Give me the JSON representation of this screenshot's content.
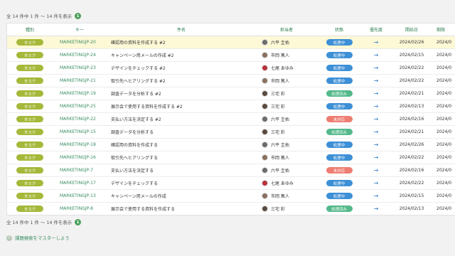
{
  "summary": {
    "text": "全 14 件中 1 件 〜 14 件を表示",
    "badge": "1"
  },
  "headers": {
    "type": "種別",
    "key": "キー",
    "subject": "件名",
    "assignee": "担当者",
    "status": "状態",
    "priority": "優先度",
    "start": "開始日",
    "due": "期限"
  },
  "colors": {
    "type": "#a6b83a",
    "processing": "#3d8fd6",
    "done": "#54b98b",
    "open": "#ee7d72",
    "accent": "#3a8e63"
  },
  "rows": [
    {
      "type": "タスク",
      "key": "MARKETINGJP-20",
      "subject": "確認用の資料を作成する #2",
      "assignee": "六平 圭佑",
      "status": "処理中",
      "status_kind": "processing",
      "priority_icon": "arrow-right-icon",
      "start": "2024/02/26",
      "due": "2024/0",
      "avatar": "#6b6b6b"
    },
    {
      "type": "タスク",
      "key": "MARKETINGJP-24",
      "subject": "キャンペーン用メールの作成 #2",
      "assignee": "市岡 篤人",
      "status": "処理中",
      "status_kind": "processing",
      "priority_icon": "arrow-right-icon",
      "start": "2024/02/15",
      "due": "2024/0",
      "avatar": "#8a7060"
    },
    {
      "type": "タスク",
      "key": "MARKETINGJP-23",
      "subject": "デザインをチェックする #2",
      "assignee": "七尾 あゆみ",
      "status": "処理中",
      "status_kind": "processing",
      "priority_icon": "arrow-right-icon",
      "start": "2024/02/22",
      "due": "2024/0",
      "avatar": "#b8323a"
    },
    {
      "type": "タスク",
      "key": "MARKETINGJP-21",
      "subject": "取引先へヒアリングする #2",
      "assignee": "市岡 篤人",
      "status": "処理中",
      "status_kind": "processing",
      "priority_icon": "arrow-right-icon",
      "start": "2024/02/22",
      "due": "2024/0",
      "avatar": "#8a7060"
    },
    {
      "type": "タスク",
      "key": "MARKETINGJP-19",
      "subject": "調査データを分析する #2",
      "assignee": "三宅 彩",
      "status": "処理済み",
      "status_kind": "done",
      "priority_icon": "arrow-right-icon",
      "start": "2024/02/21",
      "due": "2024/0",
      "avatar": "#5a4a40"
    },
    {
      "type": "タスク",
      "key": "MARKETINGJP-25",
      "subject": "展示会で使用する資料を作成する #2",
      "assignee": "三宅 彩",
      "status": "処理中",
      "status_kind": "processing",
      "priority_icon": "arrow-right-icon",
      "start": "2024/02/13",
      "due": "2024/0",
      "avatar": "#5a4a40"
    },
    {
      "type": "タスク",
      "key": "MARKETINGJP-22",
      "subject": "支払い方法を決定する #2",
      "assignee": "六平 圭佑",
      "status": "未対応",
      "status_kind": "open",
      "priority_icon": "arrow-right-icon",
      "start": "2024/02/16",
      "due": "2024/0",
      "avatar": "#6b6b6b"
    },
    {
      "type": "タスク",
      "key": "MARKETINGJP-15",
      "subject": "調査データを分析する",
      "assignee": "三宅 彩",
      "status": "処理済み",
      "status_kind": "done",
      "priority_icon": "arrow-right-icon",
      "start": "2024/02/21",
      "due": "2024/0",
      "avatar": "#5a4a40"
    },
    {
      "type": "タスク",
      "key": "MARKETINGJP-18",
      "subject": "確認用の資料を作成する",
      "assignee": "六平 圭佑",
      "status": "処理中",
      "status_kind": "processing",
      "priority_icon": "arrow-right-icon",
      "start": "2024/02/26",
      "due": "2024/0",
      "avatar": "#6b6b6b"
    },
    {
      "type": "タスク",
      "key": "MARKETINGJP-16",
      "subject": "取引先へヒアリングする",
      "assignee": "市岡 篤人",
      "status": "処理中",
      "status_kind": "processing",
      "priority_icon": "arrow-right-icon",
      "start": "2024/02/22",
      "due": "2024/0",
      "avatar": "#8a7060"
    },
    {
      "type": "タスク",
      "key": "MARKETINGJP-7",
      "subject": "支払い方法を決定する",
      "assignee": "六平 圭佑",
      "status": "未対応",
      "status_kind": "open",
      "priority_icon": "arrow-right-icon",
      "start": "2024/02/16",
      "due": "2024/0",
      "avatar": "#6b6b6b"
    },
    {
      "type": "タスク",
      "key": "MARKETINGJP-17",
      "subject": "デザインをチェックする",
      "assignee": "七尾 あゆみ",
      "status": "処理中",
      "status_kind": "processing",
      "priority_icon": "arrow-right-icon",
      "start": "2024/02/22",
      "due": "2024/0",
      "avatar": "#b8323a"
    },
    {
      "type": "タスク",
      "key": "MARKETINGJP-13",
      "subject": "キャンペーン用メールの作成",
      "assignee": "市岡 篤人",
      "status": "処理中",
      "status_kind": "processing",
      "priority_icon": "arrow-right-icon",
      "start": "2024/02/15",
      "due": "2024/0",
      "avatar": "#8a7060"
    },
    {
      "type": "タスク",
      "key": "MARKETINGJP-8",
      "subject": "展示会で使用する資料を作成する",
      "assignee": "三宅 彩",
      "status": "処理済み",
      "status_kind": "done",
      "priority_icon": "arrow-right-icon",
      "start": "2024/02/13",
      "due": "2024/0",
      "avatar": "#5a4a40"
    }
  ],
  "help": {
    "icon": "question-icon",
    "glyph": "?",
    "label": "課題検索をマスターしよう"
  }
}
